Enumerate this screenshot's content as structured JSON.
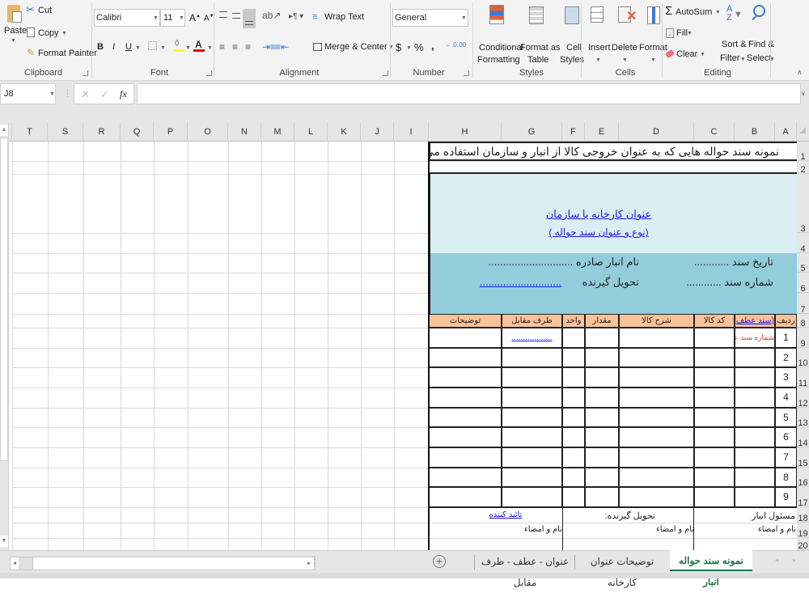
{
  "ribbon": {
    "clipboard": {
      "label": "Clipboard",
      "paste": "Paste",
      "cut": "Cut",
      "copy": "Copy",
      "format_painter": "Format Painter"
    },
    "font": {
      "label": "Font",
      "font_name": "Calibri",
      "font_size": "11",
      "bold": "B",
      "italic": "I",
      "underline": "U"
    },
    "alignment": {
      "label": "Alignment",
      "wrap_text": "Wrap Text",
      "merge_center": "Merge & Center"
    },
    "number": {
      "label": "Number",
      "format": "General",
      "currency": "$",
      "percent": "%",
      "comma": ","
    },
    "styles": {
      "label": "Styles",
      "conditional_1": "Conditional",
      "conditional_2": "Formatting",
      "format_table_1": "Format as",
      "format_table_2": "Table",
      "cell_styles_1": "Cell",
      "cell_styles_2": "Styles"
    },
    "cells": {
      "label": "Cells",
      "insert": "Insert",
      "delete": "Delete",
      "format": "Format"
    },
    "editing": {
      "label": "Editing",
      "autosum": "AutoSum",
      "fill": "Fill",
      "clear": "Clear",
      "sort_1": "Sort &",
      "sort_2": "Filter",
      "find_1": "Find &",
      "find_2": "Select"
    }
  },
  "formula_bar": {
    "name_box": "J8",
    "formula": "",
    "fx": "fx"
  },
  "columns": [
    "T",
    "S",
    "R",
    "Q",
    "P",
    "O",
    "N",
    "M",
    "L",
    "K",
    "J",
    "I",
    "H",
    "G",
    "F",
    "E",
    "D",
    "C",
    "B",
    "A"
  ],
  "rows": [
    "1",
    "2",
    "3",
    "4",
    "5",
    "6",
    "7",
    "8",
    "9",
    "10",
    "11",
    "12",
    "13",
    "14",
    "15",
    "16",
    "17",
    "18",
    "19",
    "20"
  ],
  "sheet": {
    "title": "نمونه سند حواله هایی که به عنوان خروجی کالا از انبار و  سازمان استفاده می شود",
    "company_title": "عنوان کارخانه یا سازمان",
    "doc_type": "(نوع و عنوان سند حواله )",
    "doc_date": "تاریخ سند ............",
    "doc_number": "شماره سند ............",
    "warehouse_name": "نام  انبار صادره .............................",
    "receiver_label": "تحویل گیرنده",
    "receiver_value": "............................",
    "table_headers": [
      "ردیف",
      "(سند عطف)",
      "کد کالا",
      "شرح کالا",
      "مقدار",
      "واحد",
      "طرف مقابل",
      "توضیحات"
    ],
    "row_numbers": [
      "1",
      "2",
      "3",
      "4",
      "5",
      "6",
      "7",
      "8",
      "9"
    ],
    "ref_note": "شماره سند عطف",
    "counterpart_dots": "..................",
    "sig_warehouse": "مسئول انبار",
    "sig_receiver": "تحویل گیرنده:",
    "sig_approver": "تائید کننده",
    "name_sign": "نام و امضاء"
  },
  "sheet_tabs": [
    {
      "label": "نمونه سند حواله انبار",
      "active": true
    },
    {
      "label": "توضیحات عنوان کارخانه",
      "active": false
    },
    {
      "label": "عنوان - عطف - طرف مقابل",
      "active": false
    }
  ],
  "colors": {
    "accent_green": "#217346",
    "header_fill": "#f8c29a",
    "light_blue": "#dbeef4",
    "mid_blue": "#92cddc",
    "link_blue": "#1a1ae6",
    "red_note": "#e53030"
  }
}
